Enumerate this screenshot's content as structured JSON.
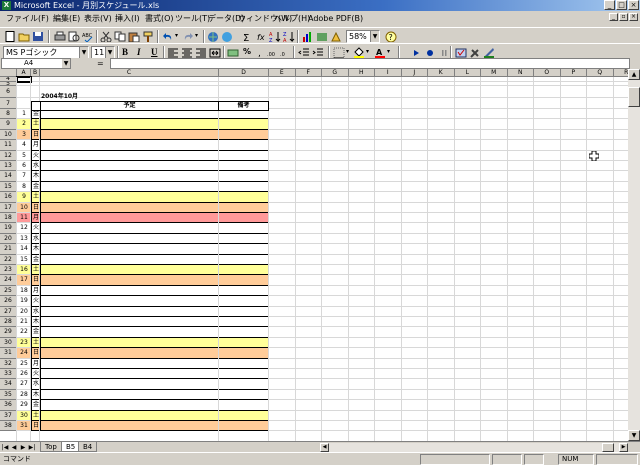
{
  "window": {
    "title": "Microsoft Excel - 月別スケジュール.xls",
    "app_icon": "excel-icon",
    "buttons": [
      "_",
      "□",
      "×"
    ]
  },
  "menu": [
    "ファイル(F)",
    "編集(E)",
    "表示(V)",
    "挿入(I)",
    "書式(O)",
    "ツール(T)",
    "データ(D)",
    "ウィンドウ(W)",
    "ヘルプ(H)",
    "Adobe PDF(B)"
  ],
  "toolbar": {
    "zoom": "58%",
    "font_name": "MS Pゴシック",
    "font_size": "11",
    "bold": "B",
    "italic": "I",
    "underline": "U",
    "percent": "%"
  },
  "formula_bar": {
    "name_box": "A4",
    "equals": "="
  },
  "columns": [
    "A",
    "B",
    "C",
    "D",
    "E",
    "F",
    "G",
    "H",
    "I",
    "J",
    "K",
    "L",
    "M",
    "N",
    "O",
    "P",
    "Q",
    "R"
  ],
  "rows": [
    "4",
    "5",
    "6",
    "7",
    "8",
    "9",
    "10",
    "11",
    "12",
    "13",
    "14",
    "15",
    "16",
    "17",
    "18",
    "19",
    "20",
    "21",
    "22",
    "23",
    "24",
    "25",
    "26",
    "27",
    "28",
    "29",
    "30",
    "31",
    "32",
    "33",
    "34",
    "35",
    "36",
    "37",
    "38"
  ],
  "sheet": {
    "title": "2004年10月",
    "header_plan": "予定",
    "header_note": "備考",
    "days": [
      {
        "day": "1",
        "wd": "金",
        "type": "weekday"
      },
      {
        "day": "2",
        "wd": "土",
        "type": "sat"
      },
      {
        "day": "3",
        "wd": "日",
        "type": "sun"
      },
      {
        "day": "4",
        "wd": "月",
        "type": "weekday"
      },
      {
        "day": "5",
        "wd": "火",
        "type": "weekday"
      },
      {
        "day": "6",
        "wd": "水",
        "type": "weekday"
      },
      {
        "day": "7",
        "wd": "木",
        "type": "weekday"
      },
      {
        "day": "8",
        "wd": "金",
        "type": "weekday"
      },
      {
        "day": "9",
        "wd": "土",
        "type": "sat"
      },
      {
        "day": "10",
        "wd": "日",
        "type": "sun"
      },
      {
        "day": "11",
        "wd": "月",
        "type": "holiday"
      },
      {
        "day": "12",
        "wd": "火",
        "type": "weekday"
      },
      {
        "day": "13",
        "wd": "水",
        "type": "weekday"
      },
      {
        "day": "14",
        "wd": "木",
        "type": "weekday"
      },
      {
        "day": "15",
        "wd": "金",
        "type": "weekday"
      },
      {
        "day": "16",
        "wd": "土",
        "type": "sat"
      },
      {
        "day": "17",
        "wd": "日",
        "type": "sun"
      },
      {
        "day": "18",
        "wd": "月",
        "type": "weekday"
      },
      {
        "day": "19",
        "wd": "火",
        "type": "weekday"
      },
      {
        "day": "20",
        "wd": "水",
        "type": "weekday"
      },
      {
        "day": "21",
        "wd": "木",
        "type": "weekday"
      },
      {
        "day": "22",
        "wd": "金",
        "type": "weekday"
      },
      {
        "day": "23",
        "wd": "土",
        "type": "sat"
      },
      {
        "day": "24",
        "wd": "日",
        "type": "sun"
      },
      {
        "day": "25",
        "wd": "月",
        "type": "weekday"
      },
      {
        "day": "26",
        "wd": "火",
        "type": "weekday"
      },
      {
        "day": "27",
        "wd": "水",
        "type": "weekday"
      },
      {
        "day": "28",
        "wd": "木",
        "type": "weekday"
      },
      {
        "day": "29",
        "wd": "金",
        "type": "weekday"
      },
      {
        "day": "30",
        "wd": "土",
        "type": "sat"
      },
      {
        "day": "31",
        "wd": "日",
        "type": "sun"
      }
    ]
  },
  "colors": {
    "sat": "#ffff99",
    "sun": "#ffcc99",
    "holiday": "#ff9999"
  },
  "tabs": [
    "Top",
    "B5",
    "B4"
  ],
  "active_tab": "B5",
  "status": {
    "mode": "コマンド",
    "num": "NUM"
  }
}
